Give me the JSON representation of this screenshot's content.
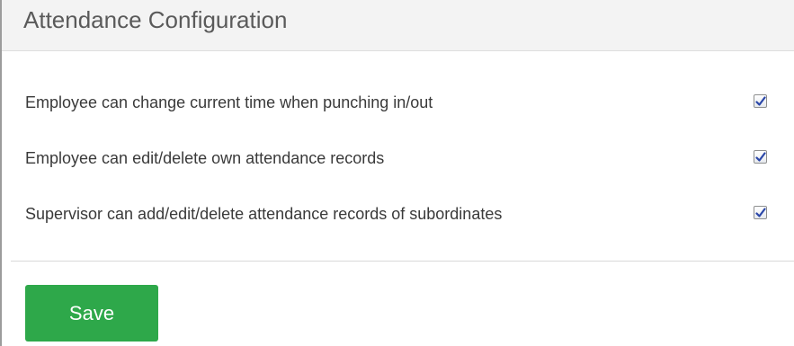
{
  "panel": {
    "title": "Attendance Configuration"
  },
  "settings": [
    {
      "label": "Employee can change current time when punching in/out",
      "checked": true,
      "icon": "check-icon"
    },
    {
      "label": "Employee can edit/delete own attendance records",
      "checked": true,
      "icon": "check-icon"
    },
    {
      "label": "Supervisor can add/edit/delete attendance records of subordinates",
      "checked": true,
      "icon": "check-icon"
    }
  ],
  "actions": {
    "save_label": "Save"
  },
  "colors": {
    "save_button": "#2ea84a",
    "header_bg": "#f3f3f3",
    "check_mark": "#2b47a8"
  }
}
